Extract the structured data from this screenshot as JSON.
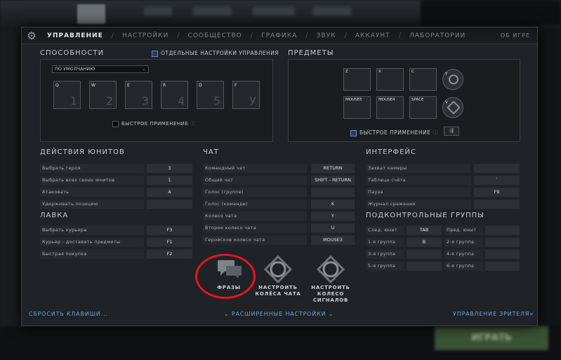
{
  "tabs": [
    {
      "label": "УПРАВЛЕНИЕ",
      "active": true
    },
    {
      "label": "НАСТРОЙКИ"
    },
    {
      "label": "СООБЩЕСТВО"
    },
    {
      "label": "ГРАФИКА"
    },
    {
      "label": "ЗВУК"
    },
    {
      "label": "АККАУНТ"
    },
    {
      "label": "ЛАБОРАТОРИИ"
    }
  ],
  "about_label": "ОБ ИГРЕ",
  "background": {
    "play_label": "ИГРАТЬ"
  },
  "abilities": {
    "title": "СПОСОБНОСТИ",
    "separate_settings_label": "ОТДЕЛЬНЫЕ НАСТРОЙКИ УПРАВЛЕНИЯ",
    "preset_value": "ПО УМОЛЧАНИЮ",
    "keys": [
      {
        "bind": "Q",
        "slot": "1"
      },
      {
        "bind": "W",
        "slot": "2"
      },
      {
        "bind": "E",
        "slot": "3"
      },
      {
        "bind": "R",
        "slot": "4"
      },
      {
        "bind": "D",
        "slot": "5"
      },
      {
        "bind": "F",
        "slot": "У"
      }
    ],
    "quickcast_label": "БЫСТРОЕ ПРИМЕНЕНИЕ"
  },
  "items": {
    "title": "ПРЕДМЕТЫ",
    "slots": [
      "Z",
      "X",
      "C",
      "MOUSE5",
      "MOUSE4",
      "SPACE"
    ],
    "round_slots": [
      "T",
      "V"
    ],
    "quickcast_label": "БЫСТРОЕ ПРИМЕНЕНИЕ"
  },
  "unit_actions": {
    "title": "ДЕЙСТВИЯ ЮНИТОВ",
    "rows": [
      {
        "name": "Выбрать героя",
        "value": "3"
      },
      {
        "name": "Выбрать всех своих юнитов",
        "value": "1"
      },
      {
        "name": "Атаковать",
        "value": "A"
      },
      {
        "name": "Удерживать позицию",
        "value": ""
      }
    ]
  },
  "shop": {
    "title": "ЛАВКА",
    "rows": [
      {
        "name": "Выбрать курьера",
        "value": "F3"
      },
      {
        "name": "Курьер - доставить предметы",
        "value": "F1"
      },
      {
        "name": "Быстрая покупка",
        "value": "F2"
      }
    ]
  },
  "chat": {
    "title": "ЧАТ",
    "rows": [
      {
        "name": "Командный чат",
        "value": "RETURN"
      },
      {
        "name": "Общий чат",
        "value": "SHIFT - RETURN"
      },
      {
        "name": "Голос (группе)",
        "value": ""
      },
      {
        "name": "Голос (команде)",
        "value": "K"
      },
      {
        "name": "Колесо чата",
        "value": "Y"
      },
      {
        "name": "Второе колесо чата",
        "value": "U"
      },
      {
        "name": "Геройское колесо чата",
        "value": "MOUSE3"
      }
    ],
    "phrases_label": "ФРАЗЫ",
    "config_wheels_label_1": "НАСТРОИТЬ",
    "config_wheels_label_2": "КОЛЁСА ЧАТА",
    "config_signal_label_1": "НАСТРОИТЬ",
    "config_signal_label_2": "КОЛЕСО",
    "config_signal_label_3": "СИГНАЛОВ"
  },
  "interface": {
    "title": "ИНТЕРФЕЙС",
    "rows": [
      {
        "name": "Захват камеры",
        "value": ""
      },
      {
        "name": "Таблица счёта",
        "value": "`"
      },
      {
        "name": "Пауза",
        "value": "F9"
      },
      {
        "name": "Журнал сражения",
        "value": ""
      }
    ]
  },
  "control_groups": {
    "title": "ПОДКОНТРОЛЬНЫЕ ГРУППЫ",
    "rows": [
      {
        "left": "След. юнит",
        "left_value": "TAB",
        "right": "Пред. юнит",
        "right_value": ""
      },
      {
        "left": "1-я группа",
        "left_value": "B",
        "right": "2-я группа",
        "right_value": ""
      },
      {
        "left": "3-я группа",
        "left_value": "",
        "right": "4-я группа",
        "right_value": ""
      },
      {
        "left": "5-я группа",
        "left_value": "",
        "right": "6-я группа",
        "right_value": ""
      }
    ]
  },
  "footer": {
    "reset_label": "СБРОСИТЬ КЛАВИШИ...",
    "advanced_label": "РАСШИРЕННЫЕ НАСТРОЙКИ",
    "spectator_label": "УПРАВЛЕНИЕ ЗРИТЕЛЯ»"
  },
  "annotation_color": "#e8141e"
}
